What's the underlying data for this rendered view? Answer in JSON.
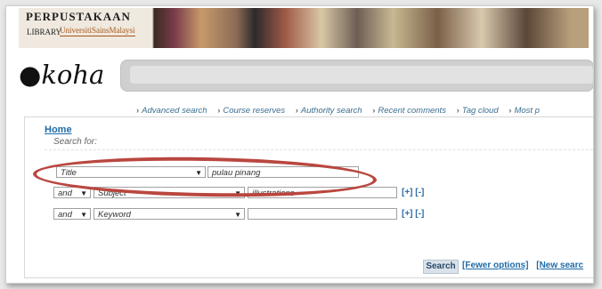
{
  "header": {
    "library_name": "PERPUSTAKAAN",
    "library_sub": "LIBRARY",
    "library_tagline": "UniversitiSainsMalaysia",
    "logo_text": "koha"
  },
  "nav": {
    "items": [
      "Advanced search",
      "Course reserves",
      "Authority search",
      "Recent comments",
      "Tag cloud",
      "Most p"
    ]
  },
  "breadcrumb": {
    "home": "Home"
  },
  "search": {
    "label": "Search for:",
    "rows": [
      {
        "operator": "",
        "field": "Title",
        "value": "pulau pinang"
      },
      {
        "operator": "and",
        "field": "Subject",
        "value": "illustrations"
      },
      {
        "operator": "and",
        "field": "Keyword",
        "value": ""
      }
    ],
    "plus": "[+]",
    "minus": "[-]",
    "search_button": "Search",
    "fewer_options": "[Fewer options]",
    "new_search": "[New searc"
  },
  "colors": {
    "highlight_oval": "#b9473f",
    "link": "#1f6aa8"
  }
}
